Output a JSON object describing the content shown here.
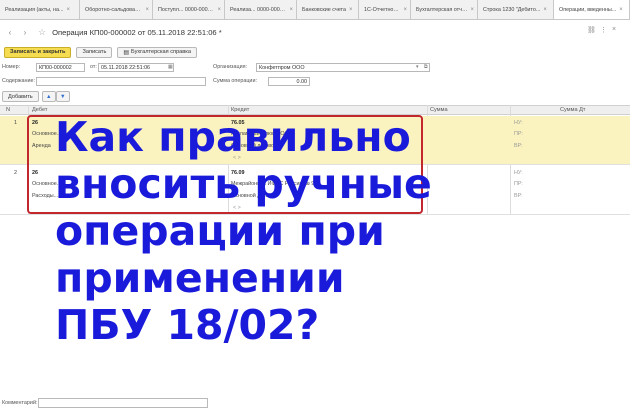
{
  "tabs": [
    {
      "label": "Реализация (акты, на..."
    },
    {
      "label": "Оборотно-сальдовая ..."
    },
    {
      "label": "Поступл... 0000-000001"
    },
    {
      "label": "Реализа... 0000-000001"
    },
    {
      "label": "Банковские счета"
    },
    {
      "label": "1С-Отчетность"
    },
    {
      "label": "Бухгалтерская отче..."
    },
    {
      "label": "Строка 1230 \"Дебито..."
    },
    {
      "label": "Операции, введенны..."
    }
  ],
  "title": "Операция КП00-000002 от 05.11.2018 22:51:06 *",
  "toolbar": {
    "save_close": "Записать и закрыть",
    "save": "Записать",
    "report": "Бухгалтерская справка"
  },
  "form": {
    "number_label": "Номер:",
    "number_value": "КП00-000002",
    "date_label": "от:",
    "date_value": "05.11.2018 22:51:06",
    "org_label": "Организация:",
    "org_value": "Конфетпром ООО",
    "content_label": "Содержание:",
    "content_value": "",
    "sum_label": "Сумма операции:",
    "sum_value": "0.00",
    "add_button": "Добавить"
  },
  "table": {
    "headers": {
      "n": "N",
      "debit": "Дебет",
      "credit": "Кредит",
      "sum": "Сумма",
      "sum_dt": "Сумма Дт"
    },
    "rows": [
      {
        "n": "1",
        "debit": [
          "26",
          "Основное...",
          "Аренда"
        ],
        "credit": [
          "76.05",
          "Рекламный Плюс ООО",
          "Основной договор"
        ],
        "sum_lines": [
          "НУ:",
          "ПР:",
          "ВР:"
        ]
      },
      {
        "n": "2",
        "debit": [
          "26",
          "Основное...",
          "Расходы..."
        ],
        "credit": [
          "76.09",
          "Межрайонная ИФНС России № 9",
          "Основной договор"
        ],
        "sum_lines": [
          "НУ:",
          "ПР:",
          "ВР:"
        ]
      }
    ]
  },
  "comment_label": "Комментарий:",
  "headline": [
    "Как правильно",
    "вносить ручные",
    "операции при",
    "применении",
    "ПБУ 18/02?"
  ],
  "colors": {
    "primary_button": "#f5dc50",
    "selected_row": "#fbf3bf",
    "headline": "#1a1adb",
    "highlight_border": "#c1272d"
  }
}
